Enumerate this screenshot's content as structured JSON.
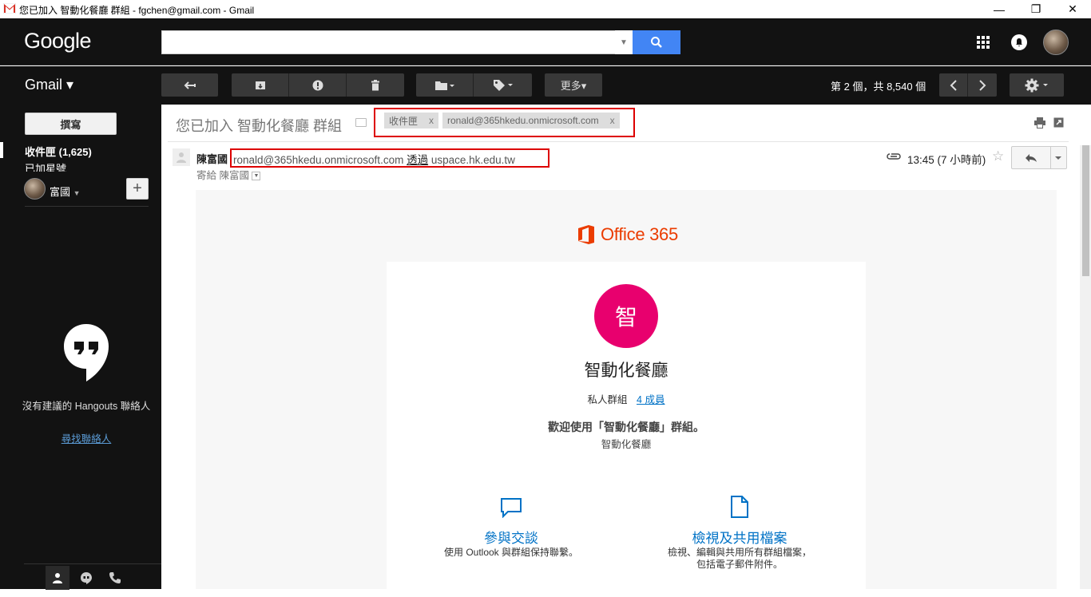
{
  "window": {
    "title": "您已加入 智動化餐廳 群組 - fgchen@gmail.com - Gmail",
    "minimize": "—",
    "restore": "❐",
    "close": "✕"
  },
  "header": {
    "logo": "Google",
    "search_value": "",
    "search_placeholder": ""
  },
  "toolbar": {
    "gmail_label": "Gmail ▾",
    "more_label": "更多▾",
    "pager": "第 2 個，共 8,540 個"
  },
  "sidebar": {
    "compose": "撰寫",
    "inbox": "收件匣 (1,625)",
    "sent": "已加星號",
    "hangout_user": "富國",
    "no_hangouts": "沒有建議的 Hangouts 聯絡人",
    "find_contacts": "尋找聯絡人"
  },
  "message": {
    "subject": "您已加入 智動化餐廳 群組",
    "labels": [
      "收件匣",
      "ronald@365hkedu.onmicrosoft.com"
    ],
    "label_remove": "x",
    "sender_name": "陳富國",
    "sender_email": "ronald@365hkedu.onmicrosoft.com",
    "via": "透過",
    "via_domain": "uspace.hk.edu.tw",
    "to_line": "寄給 陳富國",
    "time": "13:45 (7 小時前)"
  },
  "body": {
    "brand": "Office 365",
    "group_initial": "智",
    "group_name": "智動化餐廳",
    "group_type": "私人群組",
    "members": "4 成員",
    "welcome": "歡迎使用「智動化餐廳」群組。",
    "welcome_sub": "智動化餐廳",
    "features": [
      {
        "title": "參與交談",
        "desc": "使用 Outlook 與群組保持聯繫。",
        "desc2": ""
      },
      {
        "title": "檢視及共用檔案",
        "desc": "檢視、編輯與共用所有群組檔案，",
        "desc2": "包括電子郵件附件。"
      }
    ]
  },
  "colors": {
    "dark_bg": "#121212",
    "search_blue": "#4285f4",
    "office_orange": "#eb3c00",
    "group_pink": "#e8006e",
    "link_blue": "#0072c6",
    "highlight_red": "#dd0000"
  }
}
